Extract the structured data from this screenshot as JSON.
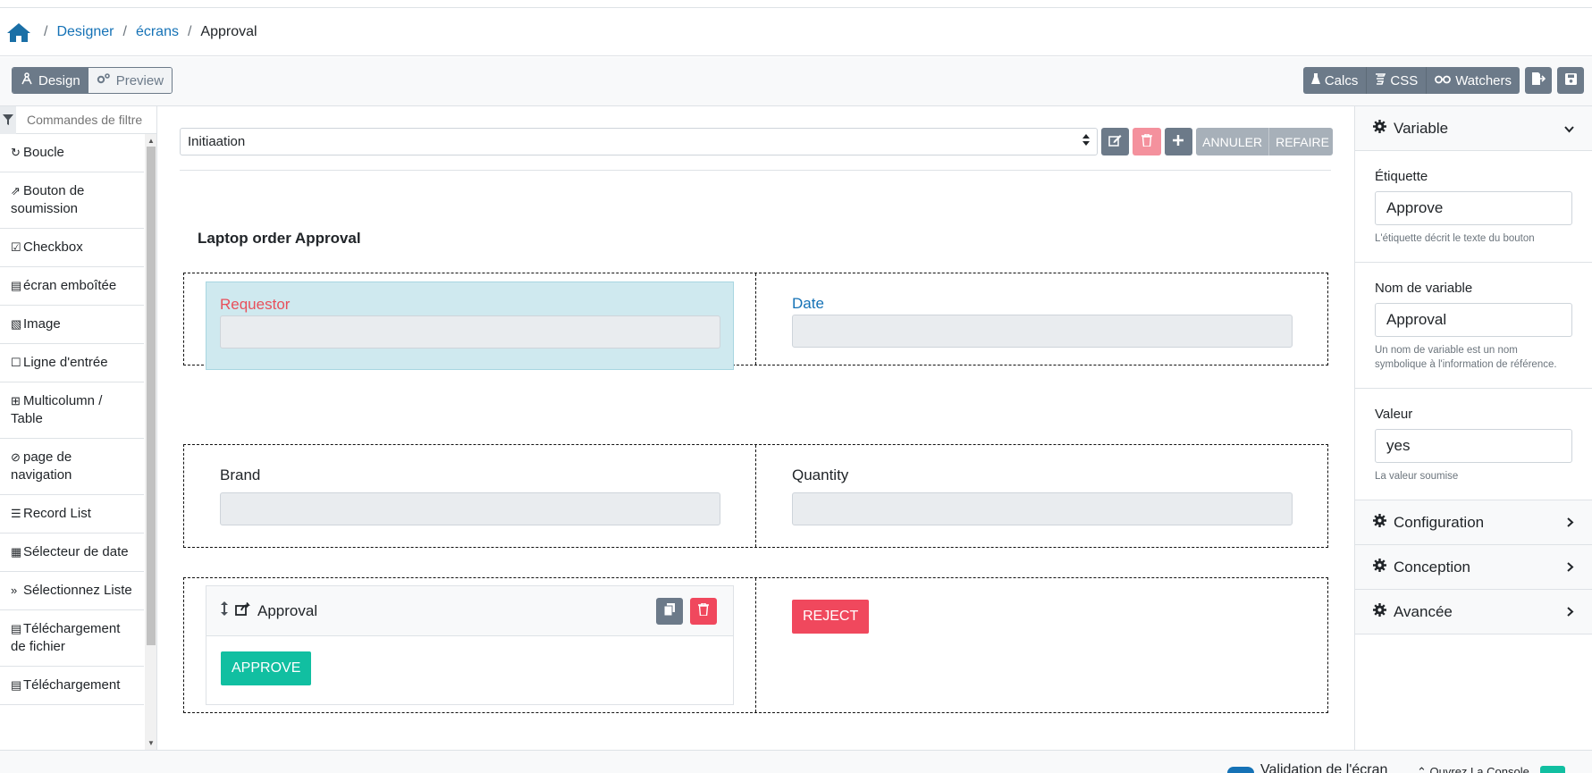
{
  "breadcrumb": {
    "home_icon": "home-icon",
    "items": [
      "Designer",
      "écrans"
    ],
    "current": "Approval"
  },
  "toolbar": {
    "design_label": "Design",
    "preview_label": "Preview",
    "calcs_label": "Calcs",
    "css_label": "CSS",
    "watchers_label": "Watchers"
  },
  "left": {
    "filter_placeholder": "Commandes de filtre",
    "components": [
      {
        "label": "Boucle",
        "icon": "redo-icon"
      },
      {
        "label": "Bouton de soumission",
        "icon": "share-square-icon"
      },
      {
        "label": "Checkbox",
        "icon": "check-square-icon"
      },
      {
        "label": "écran emboîtée",
        "icon": "file-icon"
      },
      {
        "label": "Image",
        "icon": "image-icon"
      },
      {
        "label": "Ligne d'entrée",
        "icon": "square-icon"
      },
      {
        "label": "Multicolumn / Table",
        "icon": "table-icon"
      },
      {
        "label": "page de navigation",
        "icon": "compass-icon"
      },
      {
        "label": "Record List",
        "icon": "list-icon"
      },
      {
        "label": "Sélecteur de date",
        "icon": "calendar-icon"
      },
      {
        "label": "Sélectionnez Liste",
        "icon": "chevrons-down-icon"
      },
      {
        "label": "Téléchargement de fichier",
        "icon": "file-upload-icon"
      },
      {
        "label": "Téléchargement",
        "icon": "file-download-icon"
      }
    ]
  },
  "canvas": {
    "screen_select_value": "Initiaation",
    "undo_label": "ANNULER",
    "redo_label": "REFAIRE",
    "form_title": "Laptop order Approval",
    "row1": {
      "left_label": "Requestor",
      "right_label": "Date"
    },
    "row2": {
      "left_label": "Brand",
      "right_label": "Quantity"
    },
    "row3": {
      "card_title": "Approval",
      "approve_label": "APPROVE",
      "reject_label": "REJECT"
    }
  },
  "inspector": {
    "variable_header": "Variable",
    "label_title": "Étiquette",
    "label_value": "Approve",
    "label_help": "L'étiquette décrit le texte du bouton",
    "varname_title": "Nom de variable",
    "varname_value": "Approval",
    "varname_help": "Un nom de variable est un nom symbolique à l'information de référence.",
    "value_title": "Valeur",
    "value_value": "yes",
    "value_help": "La valeur soumise",
    "configuration": "Configuration",
    "conception": "Conception",
    "advanced": "Avancée"
  },
  "bottom": {
    "validation_label": "Validation de l'écran",
    "console_label": "Ouvrez La Console"
  },
  "colors": {
    "accent": "#1572b6",
    "primary_grey": "#6c7a89",
    "approve": "#11bfa1",
    "reject": "#f0485d",
    "selected_bg": "#cfe9ef",
    "error_label": "#e8505b"
  }
}
